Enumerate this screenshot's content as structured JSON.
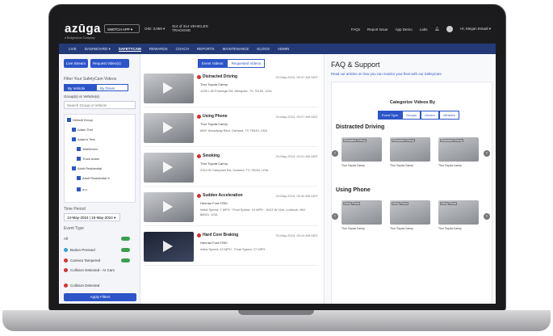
{
  "topbar": {
    "logo": "azūga",
    "logo_sub": "a Bridgestone Company",
    "switch_app": "SWITCH APP ▾",
    "obd": "OID: 3,059 ▾",
    "vehicles": "314 of 314 VEHICLES TRACKING",
    "links": [
      "FAQs",
      "Report Issue",
      "App Demo",
      "Labs"
    ],
    "user": "Hi, Megan Estadi ▾"
  },
  "nav": {
    "items": [
      "LIVE",
      "DASHBOARD ▾",
      "SAFETYCAM",
      "REWARDS",
      "COACH",
      "REPORTS",
      "MAINTENANCE",
      "ELOGS",
      "ADMIN"
    ],
    "active": "SAFETYCAM"
  },
  "sidebar": {
    "live_stream": "Live Stream",
    "request_videos": "Request Video(s)",
    "filter_label": "Filter Your SafetyCam Videos",
    "by_vehicle": "By Vehicle",
    "by_driver": "By Driver",
    "groups_title": "Group(s) or Vehicle(s)",
    "search_placeholder": "Search Group or Vehicle",
    "tree": [
      {
        "label": "Default Group",
        "indent": 0
      },
      {
        "label": "Adam Test",
        "indent": 1
      },
      {
        "label": "Adam's Test",
        "indent": 1
      },
      {
        "label": "TestDriven",
        "indent": 2
      },
      {
        "label": "Truck Adam",
        "indent": 2
      },
      {
        "label": "Adult Residential",
        "indent": 1
      },
      {
        "label": "Adult Residential S",
        "indent": 2
      },
      {
        "label": "a-n",
        "indent": 2
      }
    ],
    "time_period_label": "Time Period",
    "time_period_value": "13-May-2024 | 19-May-2024 ▾",
    "event_type_label": "Event Type",
    "events": [
      {
        "label": "All",
        "color": ""
      },
      {
        "label": "Button Pressed",
        "color": "#2aa7d6"
      },
      {
        "label": "Camera Tampered",
        "color": "#d8312d"
      },
      {
        "label": "Collision Detected - AI Cam",
        "color": "#d8312d"
      },
      {
        "label": "Collision Detected",
        "color": "#d8312d"
      }
    ],
    "apply": "Apply Filters"
  },
  "center": {
    "tabs": [
      "Event Videos",
      "Requested Videos"
    ],
    "cards": [
      {
        "event": "Distracted Driving",
        "date": "20-May-2024, 09:37 AM MDT",
        "vehicle": "Thor Toyota Camry",
        "detail": "1299 I-30 Frontage Rd, Mesquite, TX 75150, USA",
        "night": false
      },
      {
        "event": "Using Phone",
        "date": "20-May-2024, 09:27 AM MDT",
        "vehicle": "Thor Toyota Camry",
        "detail": "6897 Broadway Blvd, Garland, TX 75043, USA",
        "night": false
      },
      {
        "event": "Smoking",
        "date": "20-May-2024, 09:01 AM MDT",
        "vehicle": "Thor Toyota Camry",
        "detail": "2314 W Campbell Rd, Garland, TX 75044, USA",
        "night": false
      },
      {
        "event": "Sudden Acceleration",
        "date": "20-May-2024, 05:40 AM MDT",
        "vehicle": "Hennan Ford F250",
        "detail": "Initial Speed: 7 MPH · Final Speed: 19 MPH · 8413 W 11th, Lubbock, NM 88021, USA",
        "night": false
      },
      {
        "event": "Hard Core Braking",
        "date": "20-May-2024, 05:24 AM MDT",
        "vehicle": "Hennan Ford F250",
        "detail": "Initial Speed: 43 MPH · Final Speed: 27 MPH",
        "night": true
      }
    ]
  },
  "right": {
    "title": "FAQ & Support",
    "subtitle": "Read our articles on how you can monitor your fleet with our SafetyCam",
    "categorize": "Categorize Videos By",
    "cat_tabs": [
      "Event Type",
      "Groups",
      "Drivers",
      "Vehicles"
    ],
    "sections": [
      {
        "title": "Distracted Driving",
        "items": [
          {
            "tag": "Distracted Driving",
            "caption": "Thor Toyota Camry"
          },
          {
            "tag": "Distracted Driving",
            "caption": "Thor Toyota Camry"
          },
          {
            "tag": "Distracted Driving",
            "caption": "Thor Toyota Camry"
          }
        ]
      },
      {
        "title": "Using Phone",
        "items": [
          {
            "tag": "Using Phone",
            "caption": "Thor Toyota Camry"
          },
          {
            "tag": "Using Phone",
            "caption": "Thor Toyota Camry"
          },
          {
            "tag": "Using Phone",
            "caption": "Thor Toyota Camry"
          }
        ]
      }
    ]
  },
  "colors": {
    "accent": "#2d55c9",
    "nav": "#243a78",
    "event_dot": "#d8312d",
    "toggle": "#3aa14b"
  }
}
